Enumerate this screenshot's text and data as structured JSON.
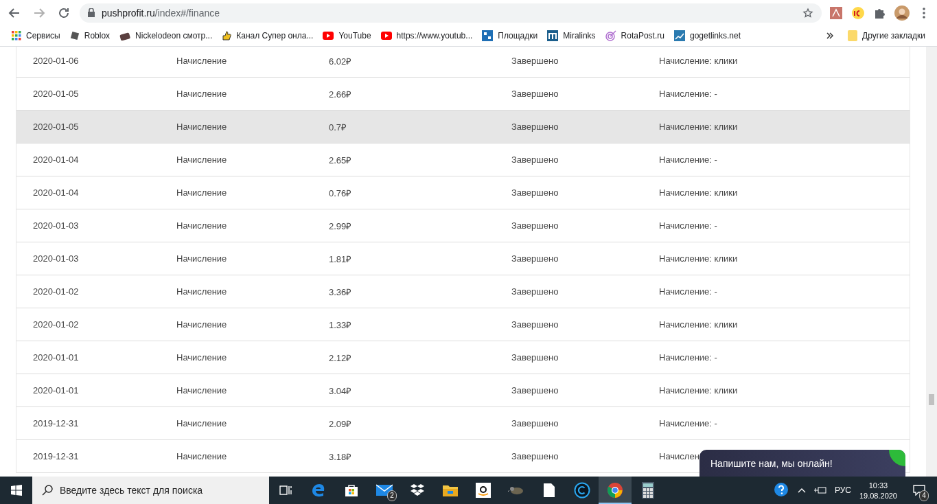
{
  "browser": {
    "url_host": "pushprofit.ru",
    "url_path": "/index#/finance"
  },
  "bookmarks": [
    {
      "label": "Сервисы"
    },
    {
      "label": "Roblox"
    },
    {
      "label": "Nickelodeon смотр..."
    },
    {
      "label": "Канал Супер онла..."
    },
    {
      "label": "YouTube"
    },
    {
      "label": "https://www.youtub..."
    },
    {
      "label": "Площадки"
    },
    {
      "label": "Miralinks"
    },
    {
      "label": "RotaPost.ru"
    },
    {
      "label": "gogetlinks.net"
    }
  ],
  "other_bookmarks": "Другие закладки",
  "rows": [
    {
      "date": "2020-01-06",
      "type": "Начисление",
      "amount": "6.02₽",
      "status": "Завершено",
      "note": "Начисление: клики",
      "selected": false
    },
    {
      "date": "2020-01-05",
      "type": "Начисление",
      "amount": "2.66₽",
      "status": "Завершено",
      "note": "Начисление: -",
      "selected": false
    },
    {
      "date": "2020-01-05",
      "type": "Начисление",
      "amount": "0.7₽",
      "status": "Завершено",
      "note": "Начисление: клики",
      "selected": true
    },
    {
      "date": "2020-01-04",
      "type": "Начисление",
      "amount": "2.65₽",
      "status": "Завершено",
      "note": "Начисление: -",
      "selected": false
    },
    {
      "date": "2020-01-04",
      "type": "Начисление",
      "amount": "0.76₽",
      "status": "Завершено",
      "note": "Начисление: клики",
      "selected": false
    },
    {
      "date": "2020-01-03",
      "type": "Начисление",
      "amount": "2.99₽",
      "status": "Завершено",
      "note": "Начисление: -",
      "selected": false
    },
    {
      "date": "2020-01-03",
      "type": "Начисление",
      "amount": "1.81₽",
      "status": "Завершено",
      "note": "Начисление: клики",
      "selected": false
    },
    {
      "date": "2020-01-02",
      "type": "Начисление",
      "amount": "3.36₽",
      "status": "Завершено",
      "note": "Начисление: -",
      "selected": false
    },
    {
      "date": "2020-01-02",
      "type": "Начисление",
      "amount": "1.33₽",
      "status": "Завершено",
      "note": "Начисление: клики",
      "selected": false
    },
    {
      "date": "2020-01-01",
      "type": "Начисление",
      "amount": "2.12₽",
      "status": "Завершено",
      "note": "Начисление: -",
      "selected": false
    },
    {
      "date": "2020-01-01",
      "type": "Начисление",
      "amount": "3.04₽",
      "status": "Завершено",
      "note": "Начисление: клики",
      "selected": false
    },
    {
      "date": "2019-12-31",
      "type": "Начисление",
      "amount": "2.09₽",
      "status": "Завершено",
      "note": "Начисление: -",
      "selected": false
    },
    {
      "date": "2019-12-31",
      "type": "Начисление",
      "amount": "3.18₽",
      "status": "Завершено",
      "note": "Начислен",
      "selected": false
    }
  ],
  "chat": {
    "text": "Напишите нам, мы онлайн!"
  },
  "taskbar": {
    "search_placeholder": "Введите здесь текст для поиска",
    "mail_badge": "2",
    "language": "РУС",
    "time": "10:33",
    "date": "19.08.2020",
    "notification_badge": "4",
    "apps": [
      {
        "kind": "taskview",
        "active": false
      },
      {
        "kind": "edge",
        "active": false
      },
      {
        "kind": "store",
        "active": false
      },
      {
        "kind": "mail",
        "active": false
      },
      {
        "kind": "dropbox",
        "active": false
      },
      {
        "kind": "explorer",
        "active": false
      },
      {
        "kind": "amazon",
        "active": false
      },
      {
        "kind": "gimp",
        "active": false
      },
      {
        "kind": "file",
        "active": false
      },
      {
        "kind": "ccleaner",
        "active": false
      },
      {
        "kind": "chrome",
        "active": true
      },
      {
        "kind": "calculator",
        "active": false
      }
    ]
  }
}
